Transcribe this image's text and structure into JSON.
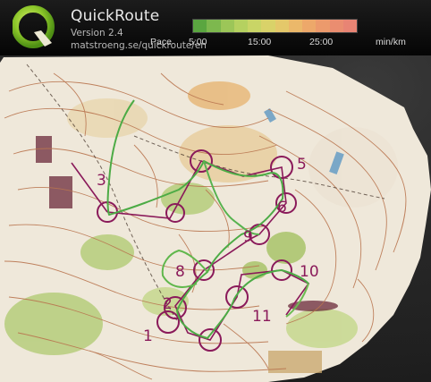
{
  "app": {
    "title": "QuickRoute",
    "version": "Version 2.4",
    "url": "matstroeng.se/quickroute/en"
  },
  "pace_scale": {
    "label": "Pace",
    "ticks": [
      "5:00",
      "15:00",
      "25:00"
    ],
    "unit": "min/km",
    "colors": [
      "#5aa640",
      "#7db84e",
      "#9cc658",
      "#b5d160",
      "#c9d566",
      "#d9d269",
      "#e4c86a",
      "#ebb86a",
      "#eda86a",
      "#ec9a6c",
      "#ea8d70",
      "#e88474"
    ]
  },
  "map": {
    "control_labels": [
      "1",
      "2",
      "3",
      "5",
      "6",
      "8",
      "9",
      "10",
      "11"
    ],
    "colors": {
      "paper": "#f1ebde",
      "contour": "#b9754f",
      "vegetation": "#a9c46a",
      "course": "#8a1a5a",
      "route": "#57b34f"
    }
  }
}
